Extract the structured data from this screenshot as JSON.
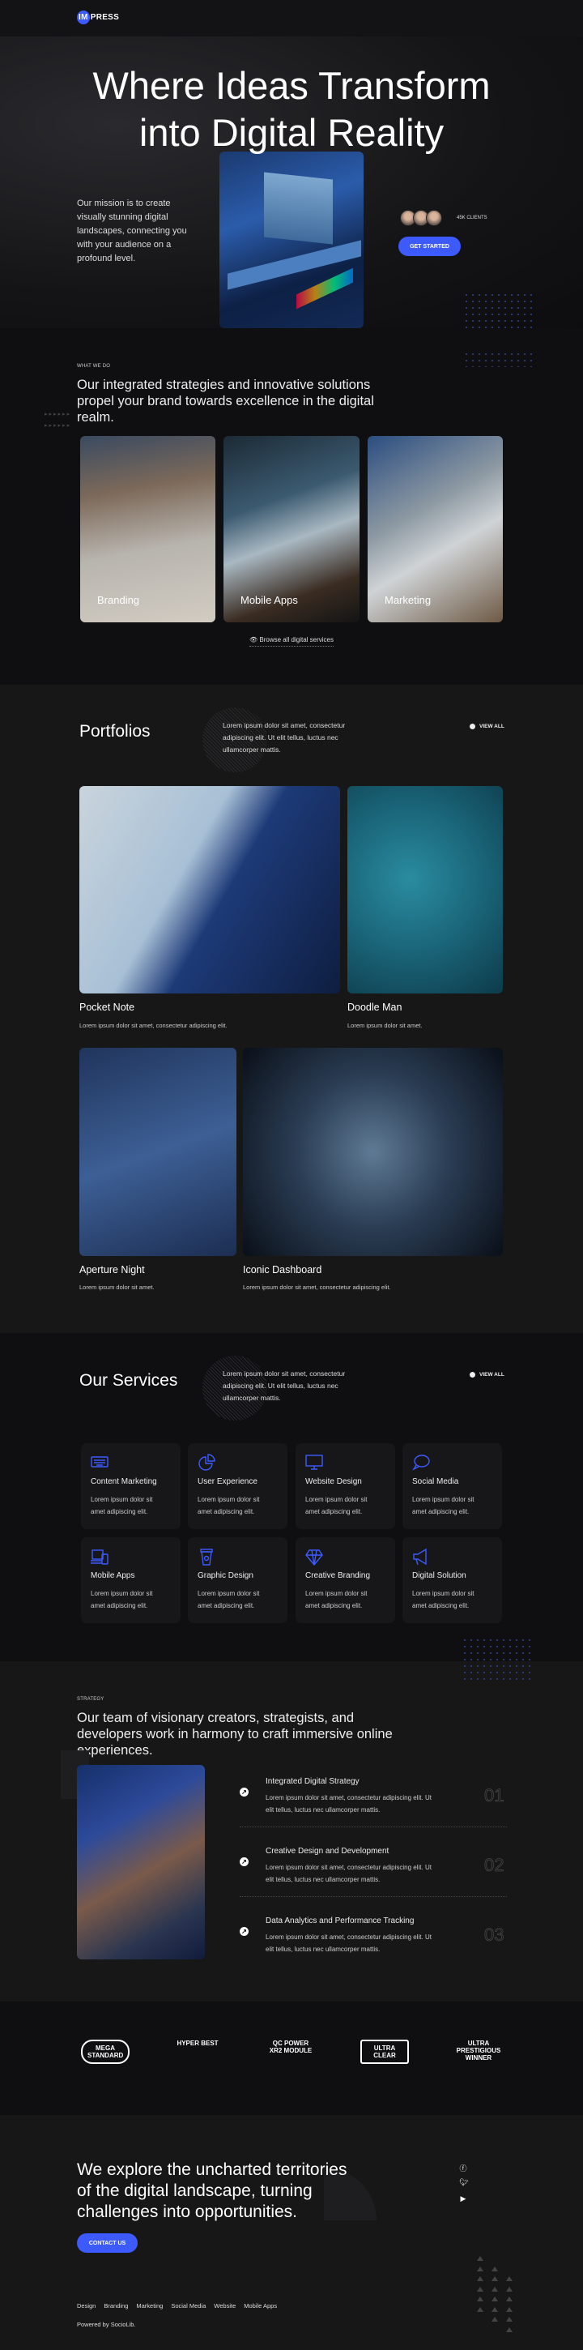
{
  "nav": {
    "logo_highlight": "IM",
    "logo_rest": "PRESS"
  },
  "hero": {
    "title_line1": "Where Ideas Transform",
    "title_line2": "into Digital Reality",
    "mission": "Our mission is to create visually stunning digital landscapes, connecting you with your audience on a profound level.",
    "clients": "45K CLIENTS",
    "cta": "GET STARTED"
  },
  "whatwedo": {
    "eyebrow": "WHAT WE DO",
    "heading": "Our integrated strategies and innovative solutions propel your brand towards excellence in the digital realm.",
    "cards": [
      {
        "label": "Branding"
      },
      {
        "label": "Mobile Apps"
      },
      {
        "label": "Marketing"
      }
    ],
    "browse": "Browse all digital services"
  },
  "portfolio": {
    "title": "Portfolios",
    "desc": "Lorem ipsum dolor sit amet, consectetur adipiscing elit. Ut elit tellus, luctus nec ullamcorper mattis.",
    "view_all": "VIEW ALL",
    "items": [
      {
        "title": "Pocket Note",
        "desc": "Lorem ipsum dolor sit amet, consectetur adipiscing elit."
      },
      {
        "title": "Doodle Man",
        "desc": "Lorem ipsum dolor sit amet."
      },
      {
        "title": "Aperture Night",
        "desc": "Lorem ipsum dolor sit amet."
      },
      {
        "title": "Iconic Dashboard",
        "desc": "Lorem ipsum dolor sit amet, consectetur adipiscing elit."
      }
    ]
  },
  "services": {
    "title": "Our Services",
    "desc": "Lorem ipsum dolor sit amet, consectetur adipiscing elit. Ut elit tellus, luctus nec ullamcorper mattis.",
    "view_all": "VIEW ALL",
    "items": [
      {
        "title": "Content Marketing",
        "desc": "Lorem ipsum dolor sit amet adipiscing elit.",
        "icon": "keyboard-icon"
      },
      {
        "title": "User Experience",
        "desc": "Lorem ipsum dolor sit amet adipiscing elit.",
        "icon": "pie-chart-icon"
      },
      {
        "title": "Website Design",
        "desc": "Lorem ipsum dolor sit amet adipiscing elit.",
        "icon": "monitor-icon"
      },
      {
        "title": "Social Media",
        "desc": "Lorem ipsum dolor sit amet adipiscing elit.",
        "icon": "speech-bubble-icon"
      },
      {
        "title": "Mobile Apps",
        "desc": "Lorem ipsum dolor sit amet adipiscing elit.",
        "icon": "devices-icon"
      },
      {
        "title": "Graphic Design",
        "desc": "Lorem ipsum dolor sit amet adipiscing elit.",
        "icon": "coffee-cup-icon"
      },
      {
        "title": "Creative Branding",
        "desc": "Lorem ipsum dolor sit amet adipiscing elit.",
        "icon": "diamond-icon"
      },
      {
        "title": "Digital Solution",
        "desc": "Lorem ipsum dolor sit amet adipiscing elit.",
        "icon": "megaphone-icon"
      }
    ]
  },
  "strategy": {
    "eyebrow": "STRATEGY",
    "heading": "Our team of visionary creators, strategists, and developers work in harmony to craft immersive online experiences.",
    "items": [
      {
        "title": "Integrated Digital Strategy",
        "desc": "Lorem ipsum dolor sit amet, consectetur adipiscing elit. Ut elit tellus, luctus nec ullamcorper mattis.",
        "num": "01"
      },
      {
        "title": "Creative Design and Development",
        "desc": "Lorem ipsum dolor sit amet, consectetur adipiscing elit. Ut elit tellus, luctus nec ullamcorper mattis.",
        "num": "02"
      },
      {
        "title": "Data Analytics and Performance Tracking",
        "desc": "Lorem ipsum dolor sit amet, consectetur adipiscing elit. Ut elit tellus, luctus nec ullamcorper mattis.",
        "num": "03"
      }
    ]
  },
  "logos": [
    {
      "text": "MEGA STANDARD"
    },
    {
      "text": "HYPER BEST"
    },
    {
      "text": "QC POWER XR2 MODULE"
    },
    {
      "text": "ULTRA CLEAR"
    },
    {
      "text": "ULTRA PRESTIGIOUS WINNER"
    }
  ],
  "footer": {
    "heading": "We explore the uncharted territories of the digital landscape, turning challenges into opportunities.",
    "cta": "CONTACT US",
    "links": [
      "Design",
      "Branding",
      "Marketing",
      "Social Media",
      "Website",
      "Mobile Apps"
    ],
    "powered": "Powered by SocioLib."
  },
  "colors": {
    "accent": "#3d5afe",
    "bg_dark": "#0f0f12",
    "bg_section": "#171717"
  }
}
